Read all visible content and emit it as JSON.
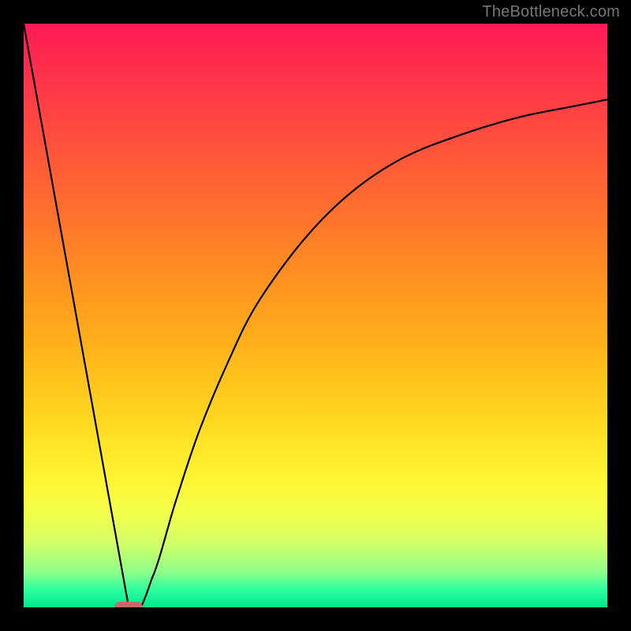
{
  "watermark": "TheBottleneck.com",
  "chart_data": {
    "type": "line",
    "title": "",
    "xlabel": "",
    "ylabel": "",
    "xlim": [
      0,
      100
    ],
    "ylim": [
      0,
      100
    ],
    "grid": false,
    "legend": false,
    "curve_points": [
      {
        "x": 0,
        "y": 100
      },
      {
        "x": 18,
        "y": 0
      },
      {
        "x": 22,
        "y": 5
      },
      {
        "x": 26,
        "y": 18
      },
      {
        "x": 30,
        "y": 30
      },
      {
        "x": 35,
        "y": 42
      },
      {
        "x": 40,
        "y": 52
      },
      {
        "x": 48,
        "y": 63
      },
      {
        "x": 56,
        "y": 71
      },
      {
        "x": 65,
        "y": 77
      },
      {
        "x": 75,
        "y": 81
      },
      {
        "x": 85,
        "y": 84
      },
      {
        "x": 95,
        "y": 86
      },
      {
        "x": 100,
        "y": 87
      }
    ],
    "marker": {
      "x": 18,
      "y": 0,
      "color": "#c46a6a"
    },
    "gradient_stops": [
      {
        "pos": 0,
        "color": "#ff1a55"
      },
      {
        "pos": 78,
        "color": "#fff533"
      },
      {
        "pos": 100,
        "color": "#00e68a"
      }
    ]
  }
}
